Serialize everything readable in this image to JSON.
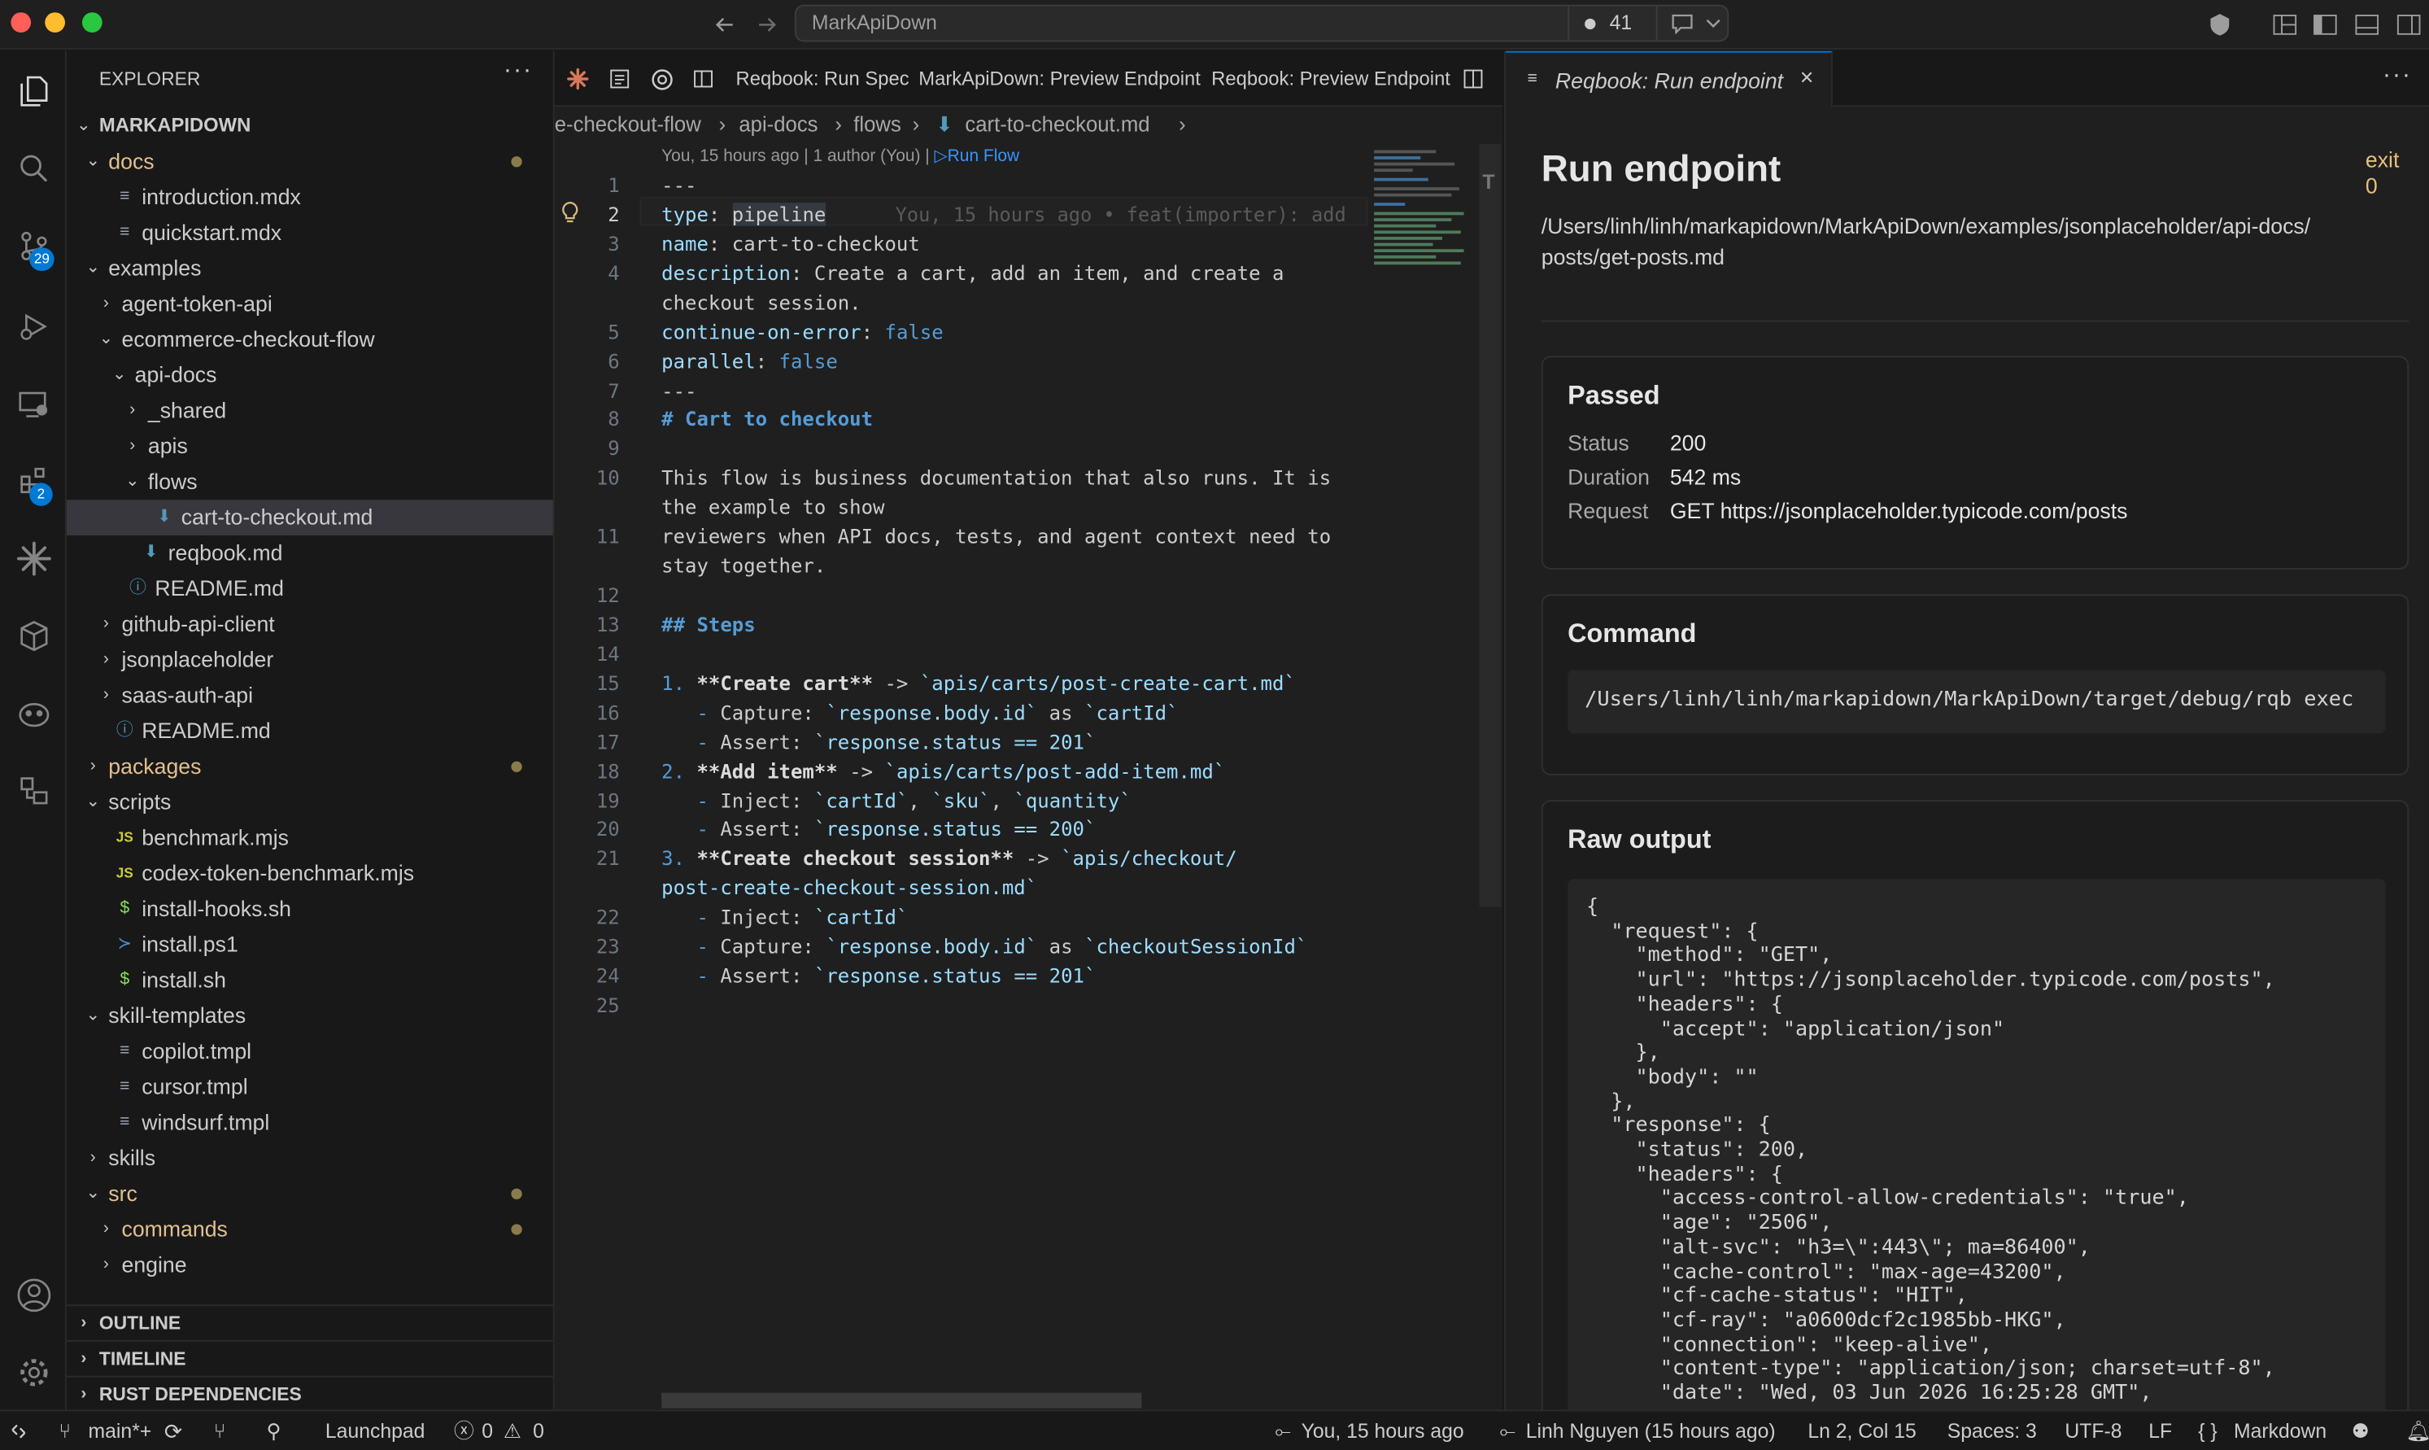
{
  "titlebar": {
    "search_text": "MarkApiDown",
    "problems_count": "41"
  },
  "activity": {
    "scm_badge": "29",
    "extensions_badge": "2"
  },
  "explorer": {
    "title": "EXPLORER",
    "root": "MARKAPIDOWN",
    "rows": [
      {
        "label": "docs",
        "type": "folder",
        "open": true,
        "modified": true
      },
      {
        "label": "introduction.mdx",
        "type": "file"
      },
      {
        "label": "quickstart.mdx",
        "type": "file"
      },
      {
        "label": "examples",
        "type": "folder",
        "open": true
      },
      {
        "label": "agent-token-api",
        "type": "folder",
        "open": false
      },
      {
        "label": "ecommerce-checkout-flow",
        "type": "folder",
        "open": true
      },
      {
        "label": "api-docs",
        "type": "folder",
        "open": true
      },
      {
        "label": "_shared",
        "type": "folder",
        "open": false
      },
      {
        "label": "apis",
        "type": "folder",
        "open": false
      },
      {
        "label": "flows",
        "type": "folder",
        "open": true
      },
      {
        "label": "cart-to-checkout.md",
        "type": "md",
        "selected": true
      },
      {
        "label": "reqbook.md",
        "type": "md"
      },
      {
        "label": "README.md",
        "type": "info"
      },
      {
        "label": "github-api-client",
        "type": "folder",
        "open": false
      },
      {
        "label": "jsonplaceholder",
        "type": "folder",
        "open": false
      },
      {
        "label": "saas-auth-api",
        "type": "folder",
        "open": false
      },
      {
        "label": "README.md",
        "type": "info"
      },
      {
        "label": "packages",
        "type": "folder",
        "open": false,
        "modified": true
      },
      {
        "label": "scripts",
        "type": "folder",
        "open": true
      },
      {
        "label": "benchmark.mjs",
        "type": "js"
      },
      {
        "label": "codex-token-benchmark.mjs",
        "type": "js"
      },
      {
        "label": "install-hooks.sh",
        "type": "sh"
      },
      {
        "label": "install.ps1",
        "type": "ps"
      },
      {
        "label": "install.sh",
        "type": "sh"
      },
      {
        "label": "skill-templates",
        "type": "folder",
        "open": true
      },
      {
        "label": "copilot.tmpl",
        "type": "file"
      },
      {
        "label": "cursor.tmpl",
        "type": "file"
      },
      {
        "label": "windsurf.tmpl",
        "type": "file"
      },
      {
        "label": "skills",
        "type": "folder",
        "open": false
      },
      {
        "label": "src",
        "type": "folder",
        "open": true,
        "modified": true
      },
      {
        "label": "commands",
        "type": "folder",
        "open": false,
        "modified": true
      },
      {
        "label": "engine",
        "type": "folder",
        "open": false
      }
    ],
    "sections": [
      "OUTLINE",
      "TIMELINE",
      "RUST DEPENDENCIES"
    ]
  },
  "editor": {
    "tabs": [
      "Reqbook: Run Spec",
      "MarkApiDown: Preview Endpoint",
      "Reqbook: Preview Endpoint"
    ],
    "breadcrumb": [
      "e-checkout-flow",
      "api-docs",
      "flows",
      "cart-to-checkout.md"
    ],
    "codelens": "You, 15 hours ago | 1 author (You) | ",
    "codelens_action": "▷Run Flow",
    "blame": "You, 15 hours ago • feat(importer): add",
    "lines": [
      {
        "n": "1",
        "segs": [
          [
            "---",
            "v"
          ]
        ]
      },
      {
        "n": "2",
        "segs": [
          [
            "type",
            "k"
          ],
          [
            ": ",
            "v"
          ],
          [
            "pipeline",
            "v"
          ]
        ]
      },
      {
        "n": "3",
        "segs": [
          [
            "name",
            "k"
          ],
          [
            ": cart-to-checkout",
            "v"
          ]
        ]
      },
      {
        "n": "4",
        "segs": [
          [
            "description",
            "k"
          ],
          [
            ": Create a cart, add an item, and create a",
            "v"
          ]
        ]
      },
      {
        "n": "",
        "segs": [
          [
            "checkout session.",
            "v"
          ]
        ]
      },
      {
        "n": "5",
        "segs": [
          [
            "continue-on-error",
            "k"
          ],
          [
            ": ",
            "v"
          ],
          [
            "false",
            "b"
          ]
        ]
      },
      {
        "n": "6",
        "segs": [
          [
            "parallel",
            "k"
          ],
          [
            ": ",
            "v"
          ],
          [
            "false",
            "b"
          ]
        ]
      },
      {
        "n": "7",
        "segs": [
          [
            "---",
            "v"
          ]
        ]
      },
      {
        "n": "8",
        "segs": [
          [
            "# Cart to checkout",
            "h"
          ]
        ]
      },
      {
        "n": "9",
        "segs": []
      },
      {
        "n": "10",
        "segs": [
          [
            "This flow is business documentation that also runs. It is",
            "v"
          ]
        ]
      },
      {
        "n": "",
        "segs": [
          [
            "the example to show",
            "v"
          ]
        ]
      },
      {
        "n": "11",
        "segs": [
          [
            "reviewers when API docs, tests, and agent context need to",
            "v"
          ]
        ]
      },
      {
        "n": "",
        "segs": [
          [
            "stay together.",
            "v"
          ]
        ]
      },
      {
        "n": "12",
        "segs": []
      },
      {
        "n": "13",
        "segs": [
          [
            "## Steps",
            "h"
          ]
        ]
      },
      {
        "n": "14",
        "segs": []
      },
      {
        "n": "15",
        "segs": [
          [
            "1. ",
            "b"
          ],
          [
            "**Create cart**",
            "bd"
          ],
          [
            " -> ",
            "v"
          ],
          [
            "`apis/carts/post-create-cart.md`",
            "s"
          ]
        ]
      },
      {
        "n": "16",
        "segs": [
          [
            "   - ",
            "b"
          ],
          [
            "Capture: ",
            "v"
          ],
          [
            "`response.body.id`",
            "s"
          ],
          [
            " as ",
            "v"
          ],
          [
            "`cartId`",
            "s"
          ]
        ]
      },
      {
        "n": "17",
        "segs": [
          [
            "   - ",
            "b"
          ],
          [
            "Assert: ",
            "v"
          ],
          [
            "`response.status == 201`",
            "s"
          ]
        ]
      },
      {
        "n": "18",
        "segs": [
          [
            "2. ",
            "b"
          ],
          [
            "**Add item**",
            "bd"
          ],
          [
            " -> ",
            "v"
          ],
          [
            "`apis/carts/post-add-item.md`",
            "s"
          ]
        ]
      },
      {
        "n": "19",
        "segs": [
          [
            "   - ",
            "b"
          ],
          [
            "Inject: ",
            "v"
          ],
          [
            "`cartId`",
            "s"
          ],
          [
            ", ",
            "v"
          ],
          [
            "`sku`",
            "s"
          ],
          [
            ", ",
            "v"
          ],
          [
            "`quantity`",
            "s"
          ]
        ]
      },
      {
        "n": "20",
        "segs": [
          [
            "   - ",
            "b"
          ],
          [
            "Assert: ",
            "v"
          ],
          [
            "`response.status == 200`",
            "s"
          ]
        ]
      },
      {
        "n": "21",
        "segs": [
          [
            "3. ",
            "b"
          ],
          [
            "**Create checkout session**",
            "bd"
          ],
          [
            " -> ",
            "v"
          ],
          [
            "`apis/checkout/",
            "s"
          ]
        ]
      },
      {
        "n": "",
        "segs": [
          [
            "post-create-checkout-session.md`",
            "s"
          ]
        ]
      },
      {
        "n": "22",
        "segs": [
          [
            "   - ",
            "b"
          ],
          [
            "Inject: ",
            "v"
          ],
          [
            "`cartId`",
            "s"
          ]
        ]
      },
      {
        "n": "23",
        "segs": [
          [
            "   - ",
            "b"
          ],
          [
            "Capture: ",
            "v"
          ],
          [
            "`response.body.id`",
            "s"
          ],
          [
            " as ",
            "v"
          ],
          [
            "`checkoutSessionId`",
            "s"
          ]
        ]
      },
      {
        "n": "24",
        "segs": [
          [
            "   - ",
            "b"
          ],
          [
            "Assert: ",
            "v"
          ],
          [
            "`response.status == 201`",
            "s"
          ]
        ]
      },
      {
        "n": "25",
        "segs": []
      }
    ]
  },
  "panel": {
    "tab_label": "Reqbook: Run endpoint",
    "title": "Run endpoint",
    "exit_label": "exit",
    "exit_code": "0",
    "path": "/Users/linh/linh/markapidown/MarkApiDown/examples/jsonplaceholder/api-docs/posts/get-posts.md",
    "passed": {
      "title": "Passed",
      "rows": [
        {
          "k": "Status",
          "v": "200"
        },
        {
          "k": "Duration",
          "v": "542 ms"
        },
        {
          "k": "Request",
          "v": "GET https://jsonplaceholder.typicode.com/posts"
        }
      ]
    },
    "command": {
      "title": "Command",
      "text": "/Users/linh/linh/markapidown/MarkApiDown/target/debug/rqb exec"
    },
    "raw": {
      "title": "Raw output",
      "text": "{\n  \"request\": {\n    \"method\": \"GET\",\n    \"url\": \"https://jsonplaceholder.typicode.com/posts\",\n    \"headers\": {\n      \"accept\": \"application/json\"\n    },\n    \"body\": \"\"\n  },\n  \"response\": {\n    \"status\": 200,\n    \"headers\": {\n      \"access-control-allow-credentials\": \"true\",\n      \"age\": \"2506\",\n      \"alt-svc\": \"h3=\\\":443\\\"; ma=86400\",\n      \"cache-control\": \"max-age=43200\",\n      \"cf-cache-status\": \"HIT\",\n      \"cf-ray\": \"a0600dcf2c1985bb-HKG\",\n      \"connection\": \"keep-alive\",\n      \"content-type\": \"application/json; charset=utf-8\",\n      \"date\": \"Wed, 03 Jun 2026 16:25:28 GMT\","
    }
  },
  "statusbar": {
    "branch": "main*+",
    "launchpad": "Launchpad",
    "errors": "0",
    "warnings": "0",
    "blame": "You, 15 hours ago",
    "author": "Linh Nguyen (15 hours ago)",
    "position": "Ln 2, Col 15",
    "spaces": "Spaces: 3",
    "encoding": "UTF-8",
    "eol": "LF",
    "language": "Markdown"
  }
}
